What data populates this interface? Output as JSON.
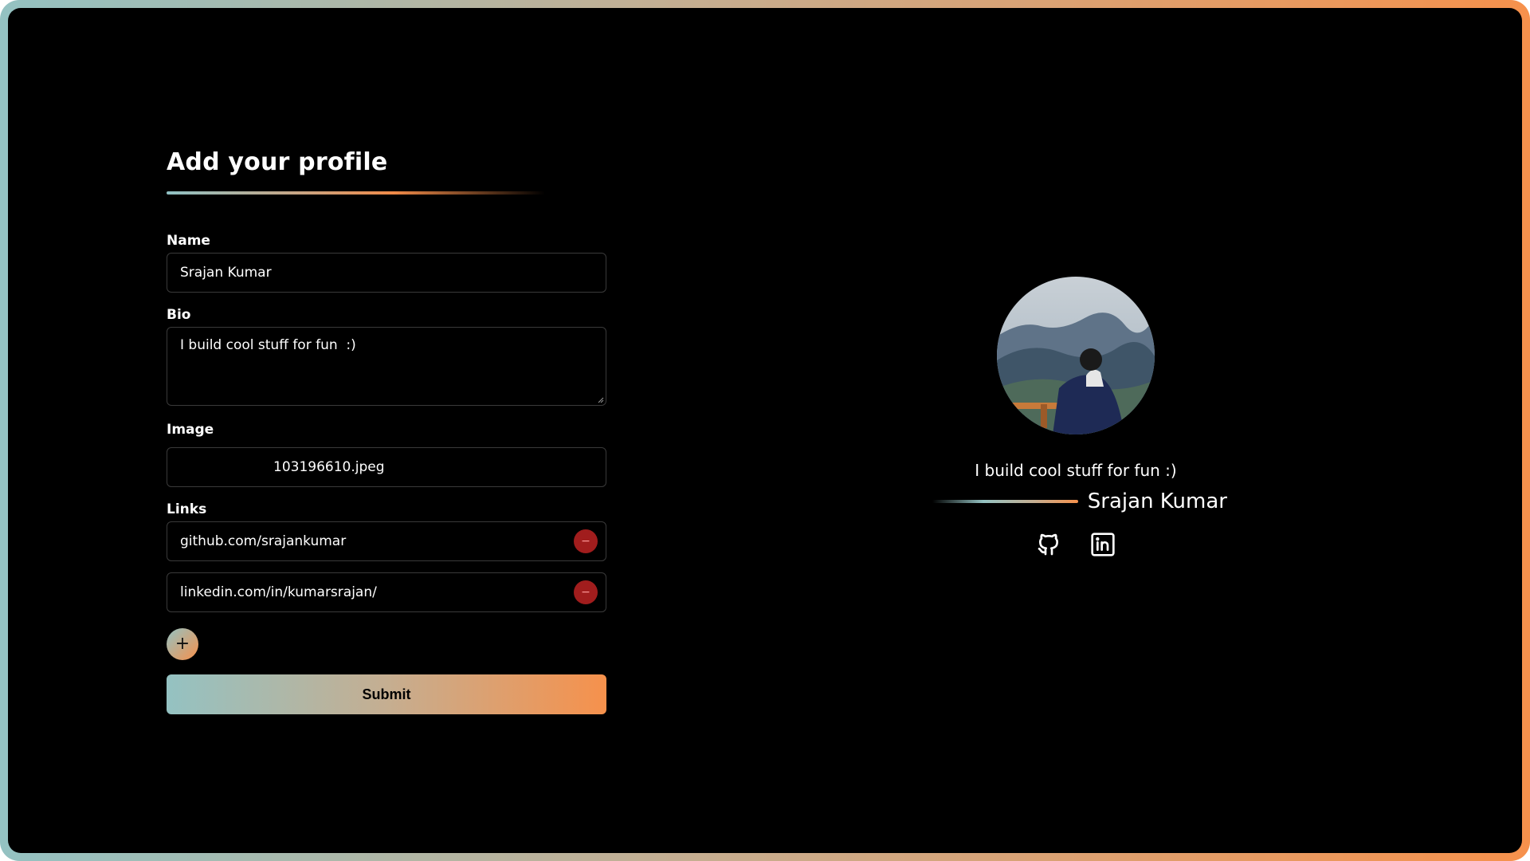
{
  "form": {
    "title": "Add your profile",
    "name_label": "Name",
    "name_value": "Srajan Kumar",
    "bio_label": "Bio",
    "bio_value": "I build cool stuff for fun  :)",
    "image_label": "Image",
    "image_filename": "103196610.jpeg",
    "links_label": "Links",
    "links": [
      {
        "value": "github.com/srajankumar",
        "remove_symbol": "−"
      },
      {
        "value": "linkedin.com/in/kumarsrajan/",
        "remove_symbol": "−"
      }
    ],
    "add_link_symbol": "+",
    "submit_label": "Submit"
  },
  "preview": {
    "bio": "I build cool stuff for fun :)",
    "name": "Srajan Kumar",
    "social_icons": [
      "github-icon",
      "linkedin-icon"
    ]
  },
  "colors": {
    "accent_gradient_start": "#94c2c2",
    "accent_gradient_mid": "#c5ae91",
    "accent_gradient_end": "#f6914c",
    "remove_button": "#a11d1d",
    "background": "#000000",
    "field_border": "#3a3a3a"
  }
}
